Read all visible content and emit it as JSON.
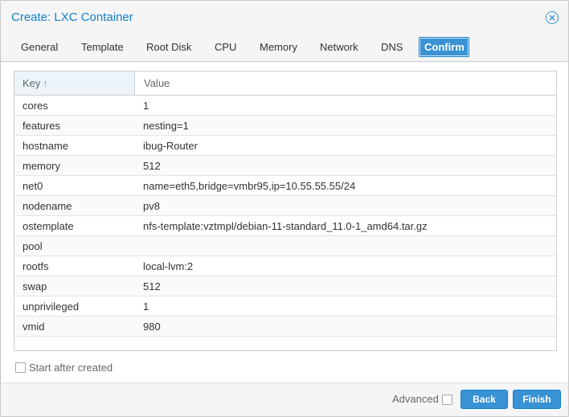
{
  "window": {
    "title": "Create: LXC Container"
  },
  "tabs": [
    {
      "label": "General"
    },
    {
      "label": "Template"
    },
    {
      "label": "Root Disk"
    },
    {
      "label": "CPU"
    },
    {
      "label": "Memory"
    },
    {
      "label": "Network"
    },
    {
      "label": "DNS"
    },
    {
      "label": "Confirm",
      "active": true
    }
  ],
  "grid": {
    "columns": {
      "key": "Key",
      "value": "Value"
    },
    "sort_icon": "sort-ascending-icon",
    "rows": [
      {
        "key": "cores",
        "value": "1"
      },
      {
        "key": "features",
        "value": "nesting=1"
      },
      {
        "key": "hostname",
        "value": "ibug-Router"
      },
      {
        "key": "memory",
        "value": "512"
      },
      {
        "key": "net0",
        "value": "name=eth5,bridge=vmbr95,ip=10.55.55.55/24"
      },
      {
        "key": "nodename",
        "value": "pv8"
      },
      {
        "key": "ostemplate",
        "value": "nfs-template:vztmpl/debian-11-standard_11.0-1_amd64.tar.gz"
      },
      {
        "key": "pool",
        "value": ""
      },
      {
        "key": "rootfs",
        "value": "local-lvm:2"
      },
      {
        "key": "swap",
        "value": "512"
      },
      {
        "key": "unprivileged",
        "value": "1"
      },
      {
        "key": "vmid",
        "value": "980"
      }
    ]
  },
  "options": {
    "start_after_created": "Start after created",
    "start_after_created_checked": false
  },
  "footer": {
    "advanced_label": "Advanced",
    "advanced_checked": false,
    "back_label": "Back",
    "finish_label": "Finish"
  },
  "colors": {
    "accent": "#3892d4",
    "title": "#157fcc",
    "header_key_bg": "#ecf4fa"
  }
}
